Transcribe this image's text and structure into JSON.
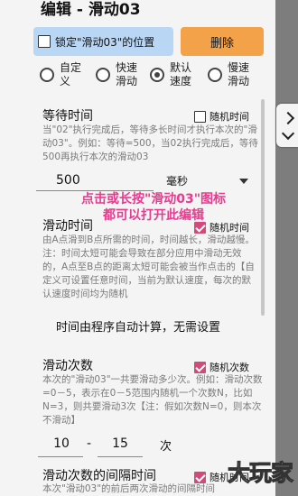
{
  "dialog": {
    "title": "编辑 - 滑动03",
    "lock_label": "锁定\"滑动03\"的位置",
    "delete_label": "删除"
  },
  "speed_options": [
    {
      "label": "自定义",
      "selected": false
    },
    {
      "label": "快速滑动",
      "selected": false
    },
    {
      "label": "默认速度",
      "selected": true
    },
    {
      "label": "慢速滑动",
      "selected": false
    }
  ],
  "wait": {
    "title": "等待时间",
    "random_label": "随机时间",
    "random_checked": false,
    "desc": "当\"02\"执行完成后，等待多长时间才执行本次的\"滑动03\"。例如：等待=500，当02执行完成后，等待500再执行本次的滑动03",
    "value": "500",
    "unit": "毫秒"
  },
  "overlay_tip": "点击或长按\"滑动03\"图标\n都可以打开此编辑",
  "slide_time": {
    "title": "滑动时间",
    "random_label": "随机时间",
    "random_checked": true,
    "desc": "由A点滑到B点所需的时间，时间越长，滑动越慢。注：时间太短可能会导致在部分应用中滑动无效的，A点至B点的距离太短可能会被当作点击的【自定义可设置任意时间，当前为默认速度，每次的默认速度时间均为随机",
    "auto_note": "时间由程序自动计算，无需设置"
  },
  "slide_count": {
    "title": "滑动次数",
    "random_label": "随机次数",
    "random_checked": true,
    "desc": "本次的\"滑动03\"一共要滑动多少次。例如：滑动次数=0－5，表示在0－5范围内随机一个次数N，比如N=3，则共要滑动3次【注：假如次数N=0，则本次不滑动】",
    "min": "10",
    "separator": "-",
    "max": "15",
    "unit": "次"
  },
  "interval": {
    "title": "滑动次数的间隔时间",
    "random_label": "随机时间",
    "random_checked": true,
    "desc": "本次\"滑动03\"的前后两次滑动的间隔时间"
  },
  "watermark": "大玩家",
  "icons": {
    "side_tab": "collapse-arrows-icon"
  }
}
